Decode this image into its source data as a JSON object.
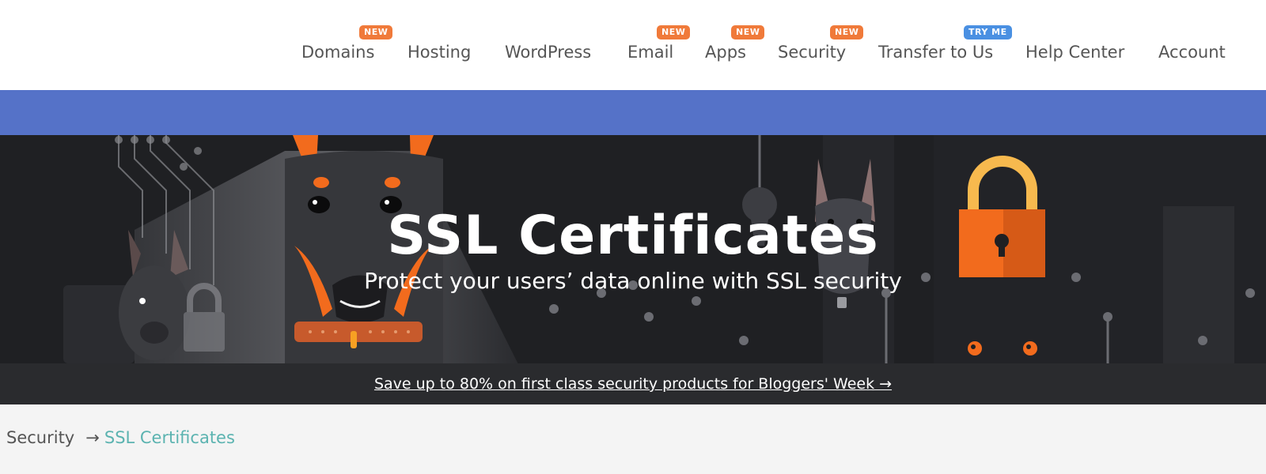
{
  "nav": {
    "items": [
      {
        "label": "Domains",
        "badge": "NEW"
      },
      {
        "label": "Hosting",
        "badge": ""
      },
      {
        "label": "WordPress",
        "badge": ""
      },
      {
        "label": "Email",
        "badge": "NEW"
      },
      {
        "label": "Apps",
        "badge": "NEW"
      },
      {
        "label": "Security",
        "badge": "NEW"
      },
      {
        "label": "Transfer to Us",
        "badge": "TRY ME"
      },
      {
        "label": "Help Center",
        "badge": ""
      },
      {
        "label": "Account",
        "badge": ""
      }
    ]
  },
  "hero": {
    "title": "SSL Certificates",
    "subtitle": "Protect your users’ data online with SSL security"
  },
  "promo": {
    "text": "Save up to 80% on first class security products for Bloggers' Week →"
  },
  "breadcrumb": {
    "parent": "Security",
    "separator": "→",
    "current": "SSL Certificates"
  },
  "colors": {
    "blue_band": "#5572c8",
    "badge_orange": "#f07a3a",
    "badge_blue": "#4a90e2",
    "accent_orange": "#f26b1d",
    "breadcrumb_current": "#5bb3b0"
  }
}
